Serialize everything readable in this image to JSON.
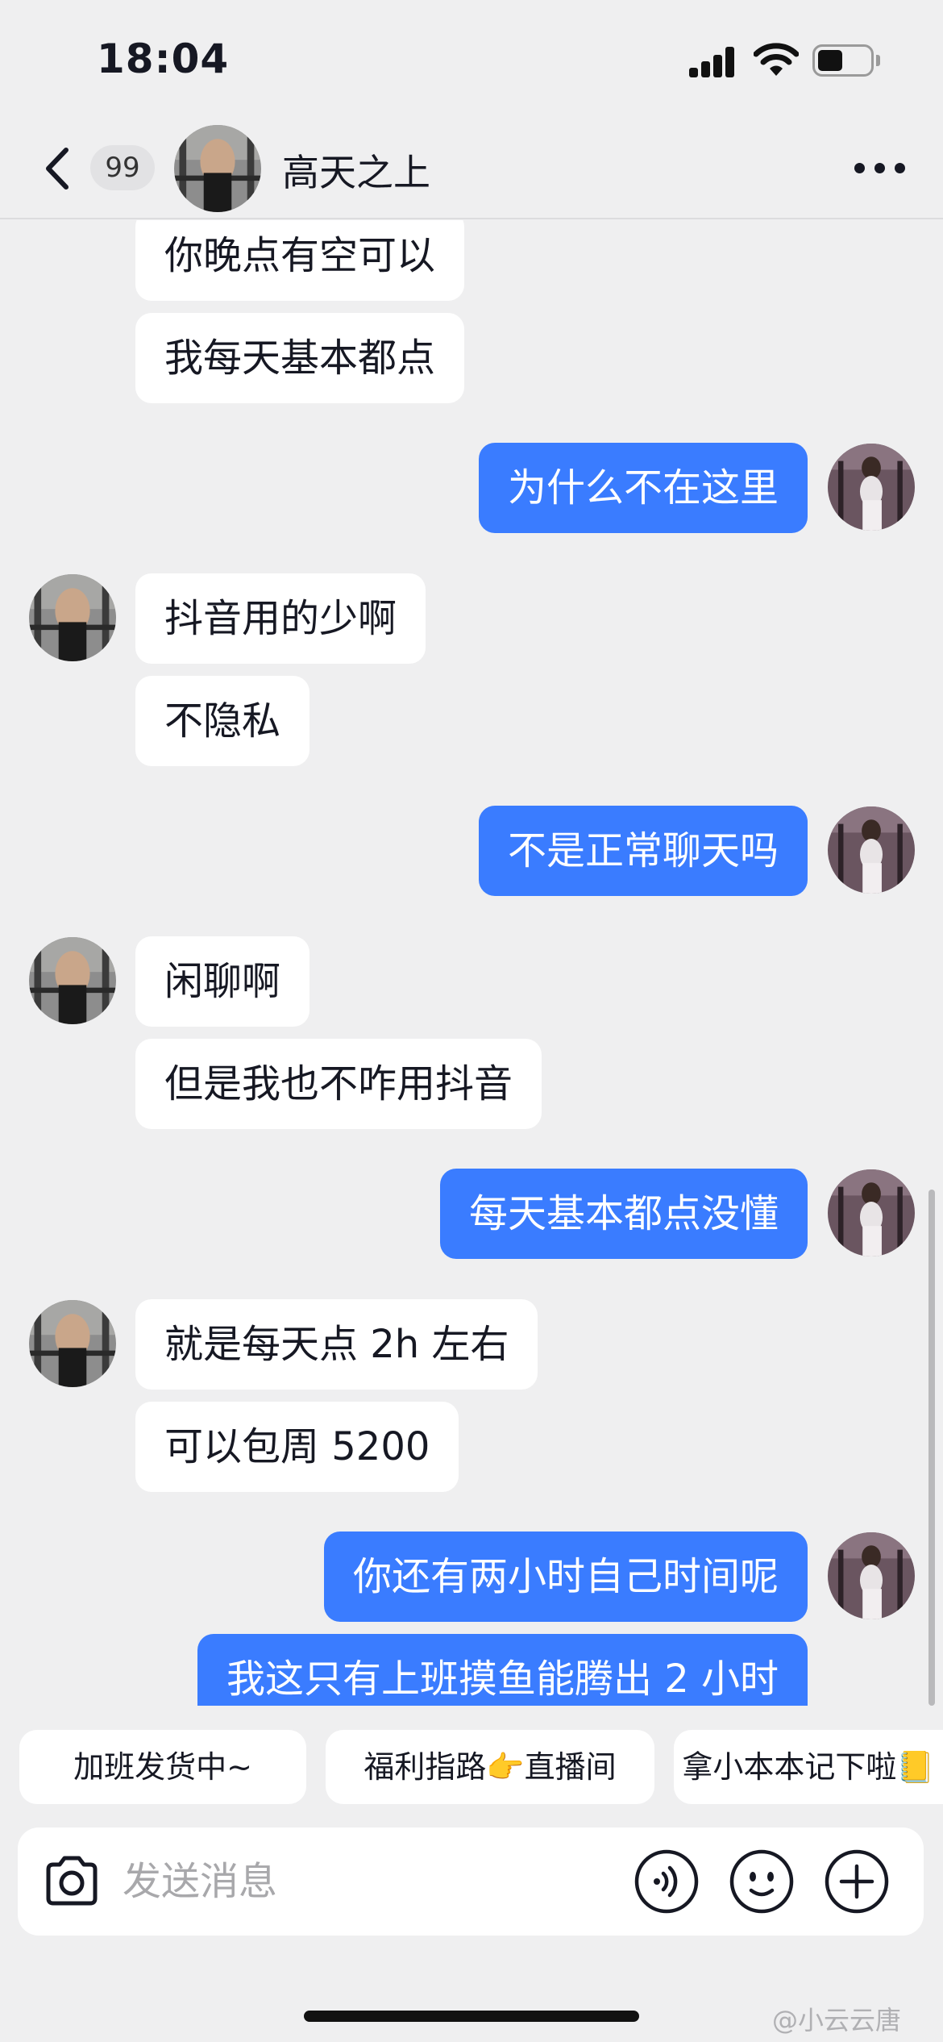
{
  "status_bar": {
    "time": "18:04"
  },
  "header": {
    "unread_count": "99",
    "contact_name": "高天之上"
  },
  "messages": [
    {
      "side": "in",
      "text": "你晚点有空可以"
    },
    {
      "side": "in",
      "text": "我每天基本都点"
    },
    {
      "side": "out",
      "text": "为什么不在这里"
    },
    {
      "side": "in",
      "text": "抖音用的少啊"
    },
    {
      "side": "in",
      "text": "不隐私"
    },
    {
      "side": "out",
      "text": "不是正常聊天吗"
    },
    {
      "side": "in",
      "text": "闲聊啊"
    },
    {
      "side": "in",
      "text": "但是我也不咋用抖音"
    },
    {
      "side": "out",
      "text": "每天基本都点没懂"
    },
    {
      "side": "in",
      "text": "就是每天点 2h 左右"
    },
    {
      "side": "in",
      "text": "可以包周 5200"
    },
    {
      "side": "out",
      "text": "你还有两小时自己时间呢"
    },
    {
      "side": "out",
      "text": "我这只有上班摸鱼能腾出 2 小时"
    }
  ],
  "quick_replies": [
    "加班发货中~",
    "福利指路👉直播间",
    "拿小本本记下啦📒"
  ],
  "input": {
    "placeholder": "发送消息"
  },
  "watermark": "@小云云唐",
  "colors": {
    "outgoing_bubble": "#3a7cff",
    "incoming_bubble": "#ffffff",
    "background": "#efeff0"
  },
  "icons": [
    "back-icon",
    "more-icon",
    "camera-icon",
    "voice-icon",
    "emoji-icon",
    "plus-icon"
  ]
}
